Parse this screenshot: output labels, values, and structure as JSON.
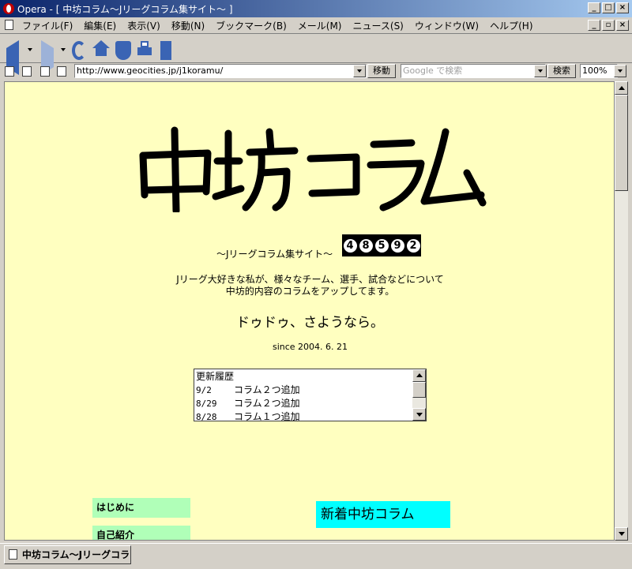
{
  "window": {
    "title": "Opera - [ 中坊コラム～Jリーグコラム集サイト～ ]"
  },
  "menu": [
    "ファイル(F)",
    "編集(E)",
    "表示(V)",
    "移動(N)",
    "ブックマーク(B)",
    "メール(M)",
    "ニュース(S)",
    "ウィンドウ(W)",
    "ヘルプ(H)"
  ],
  "address": {
    "url": "http://www.geocities.jp/j1koramu/",
    "go_label": "移動"
  },
  "search": {
    "placeholder": "Google で検索",
    "button_label": "検索"
  },
  "zoom": "100%",
  "page": {
    "logo_text": "中坊コラム",
    "subtitle": "～Jリーグコラム集サイト～",
    "counter": [
      "4",
      "8",
      "5",
      "9",
      "2"
    ],
    "description_line1": "Jリーグ大好きな私が、様々なチーム、選手、試合などについて",
    "description_line2": "中坊的内容のコラムをアップしてます。",
    "sayonara": "ドゥドゥ、さようなら。",
    "since": "since 2004. 6. 21",
    "history_title": "更新履歴",
    "history": [
      {
        "date": "9/2",
        "text": "コラム２つ追加"
      },
      {
        "date": "8/29",
        "text": "コラム２つ追加"
      },
      {
        "date": "8/28",
        "text": "コラム１つ追加"
      }
    ],
    "nav": [
      "はじめに",
      "自己紹介"
    ],
    "new_column_heading": "新着中坊コラム"
  },
  "tab": {
    "label": "中坊コラム～Jリーグコラ..."
  },
  "colors": {
    "page_bg": "#ffffc0",
    "nav_bg": "#b0ffb8",
    "heading_bg": "#00ffff",
    "counter_bg": "#000000"
  }
}
